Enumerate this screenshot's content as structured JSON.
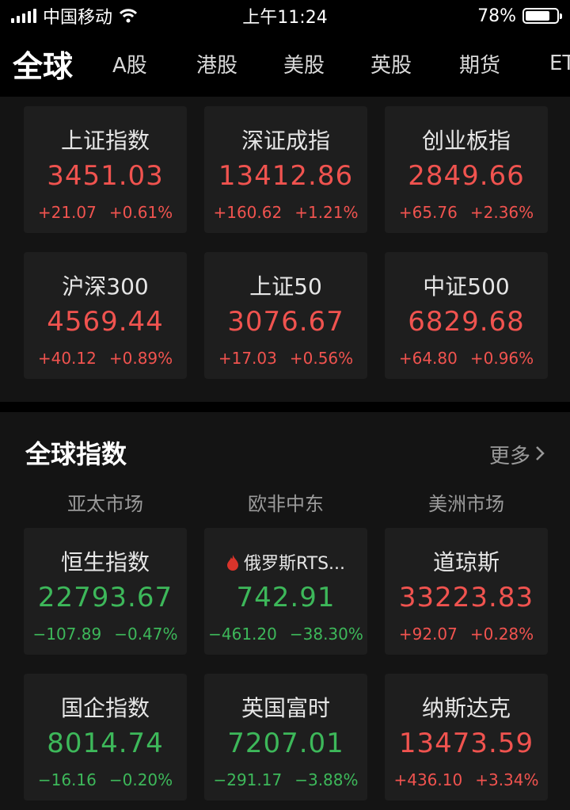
{
  "status": {
    "carrier": "中国移动",
    "time": "上午11:24",
    "battery": "78%",
    "battery_level": 0.78
  },
  "tabs": [
    "全球",
    "A股",
    "港股",
    "美股",
    "英股",
    "期货",
    "ET"
  ],
  "china_indices": [
    {
      "name": "上证指数",
      "value": "3451.03",
      "change": "+21.07",
      "pct": "+0.61%",
      "trend": "up"
    },
    {
      "name": "深证成指",
      "value": "13412.86",
      "change": "+160.62",
      "pct": "+1.21%",
      "trend": "up"
    },
    {
      "name": "创业板指",
      "value": "2849.66",
      "change": "+65.76",
      "pct": "+2.36%",
      "trend": "up"
    },
    {
      "name": "沪深300",
      "value": "4569.44",
      "change": "+40.12",
      "pct": "+0.89%",
      "trend": "up"
    },
    {
      "name": "上证50",
      "value": "3076.67",
      "change": "+17.03",
      "pct": "+0.56%",
      "trend": "up"
    },
    {
      "name": "中证500",
      "value": "6829.68",
      "change": "+64.80",
      "pct": "+0.96%",
      "trend": "up"
    }
  ],
  "global": {
    "title": "全球指数",
    "more": "更多",
    "regions": [
      "亚太市场",
      "欧非中东",
      "美洲市场"
    ],
    "indices": [
      {
        "name": "恒生指数",
        "value": "22793.67",
        "change": "−107.89",
        "pct": "−0.47%",
        "trend": "down"
      },
      {
        "name": "俄罗斯RTS...",
        "value": "742.91",
        "change": "−461.20",
        "pct": "−38.30%",
        "trend": "down",
        "hot": true
      },
      {
        "name": "道琼斯",
        "value": "33223.83",
        "change": "+92.07",
        "pct": "+0.28%",
        "trend": "up"
      },
      {
        "name": "国企指数",
        "value": "8014.74",
        "change": "−16.16",
        "pct": "−0.20%",
        "trend": "down"
      },
      {
        "name": "英国富时",
        "value": "7207.01",
        "change": "−291.17",
        "pct": "−3.88%",
        "trend": "down"
      },
      {
        "name": "纳斯达克",
        "value": "13473.59",
        "change": "+436.10",
        "pct": "+3.34%",
        "trend": "up"
      }
    ]
  },
  "colors": {
    "up": "#f0534f",
    "down": "#3db85a",
    "background": "#000000",
    "card": "#1e1e1e"
  }
}
